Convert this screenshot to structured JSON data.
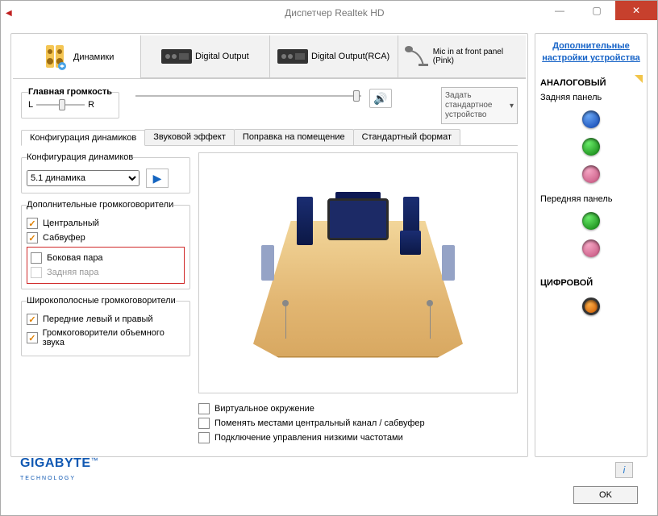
{
  "window": {
    "title": "Диспетчер Realtek HD"
  },
  "device_tabs": [
    {
      "label": "Динамики",
      "active": true
    },
    {
      "label": "Digital Output",
      "active": false
    },
    {
      "label": "Digital Output(RCA)",
      "active": false
    },
    {
      "label": "Mic in at front panel (Pink)",
      "active": false
    }
  ],
  "master_volume": {
    "legend": "Главная громкость",
    "balance_left": "L",
    "balance_right": "R",
    "default_button": "Задать стандартное устройство"
  },
  "subtabs": [
    {
      "label": "Конфигурация динамиков",
      "active": true
    },
    {
      "label": "Звуковой эффект",
      "active": false
    },
    {
      "label": "Поправка на помещение",
      "active": false
    },
    {
      "label": "Стандартный формат",
      "active": false
    }
  ],
  "speaker_config": {
    "legend": "Конфигурация динамиков",
    "selected": "5.1 динамика"
  },
  "optional_speakers": {
    "legend": "Дополнительные громкоговорители",
    "items": [
      {
        "label": "Центральный",
        "checked": true,
        "enabled": true
      },
      {
        "label": "Сабвуфер",
        "checked": true,
        "enabled": true
      },
      {
        "label": "Боковая пара",
        "checked": false,
        "enabled": true
      },
      {
        "label": "Задняя пара",
        "checked": false,
        "enabled": false
      }
    ]
  },
  "fullrange_speakers": {
    "legend": "Широкополосные громкоговорители",
    "items": [
      {
        "label": "Передние левый и правый",
        "checked": true
      },
      {
        "label": "Громкоговорители объемного звука",
        "checked": true
      }
    ]
  },
  "bottom_checks": [
    {
      "label": "Виртуальное окружение",
      "checked": false
    },
    {
      "label": "Поменять местами центральный канал / сабвуфер",
      "checked": false
    },
    {
      "label": "Подключение управления низкими частотами",
      "checked": false
    }
  ],
  "right_panel": {
    "link": "Дополнительные настройки устройства",
    "analog_title": "АНАЛОГОВЫЙ",
    "rear_panel": "Задняя панель",
    "front_panel": "Передняя панель",
    "digital_title": "ЦИФРОВОЙ"
  },
  "footer": {
    "brand_main": "GIGABYTE",
    "brand_sub": "TECHNOLOGY",
    "trademark": "™"
  },
  "ok_button": "OK"
}
